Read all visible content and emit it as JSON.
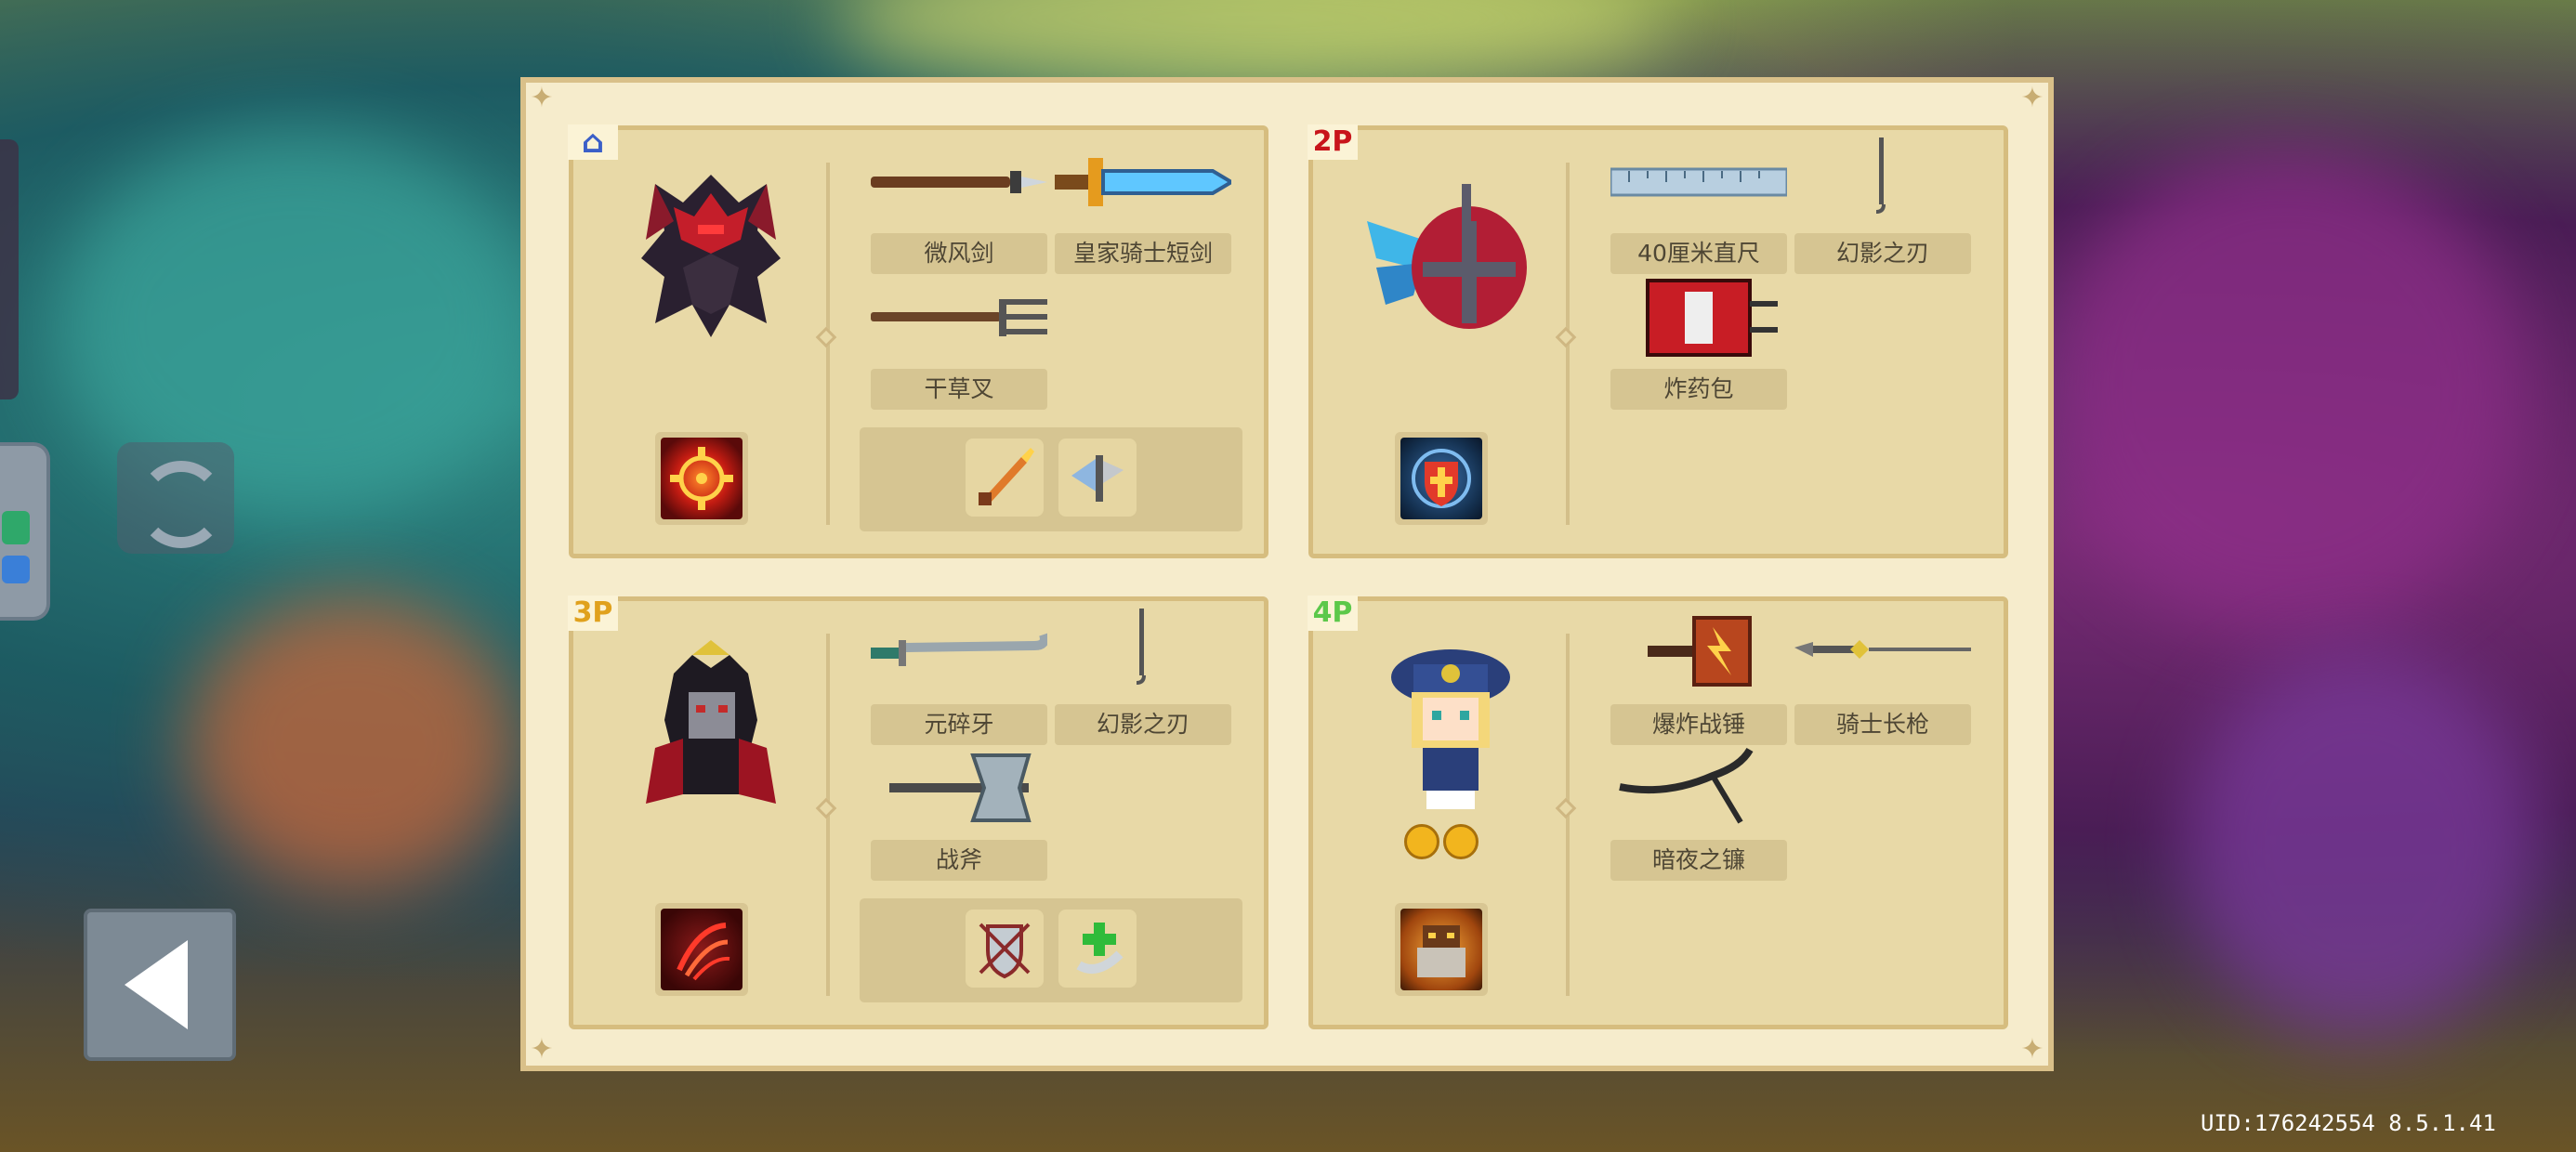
{
  "players": [
    {
      "tag": "⌂",
      "tag_color": "#3b5fc8",
      "character": "dark-red-armored-knight",
      "skill_icon": "crosshair-target-icon",
      "weapons": [
        "微风剑",
        "皇家骑士短剑",
        "干草叉"
      ],
      "buffs": [
        "flame-sword-buff-icon",
        "wing-axe-buff-icon"
      ]
    },
    {
      "tag": "2P",
      "tag_color": "#c8151b",
      "character": "winged-red-helmet",
      "skill_icon": "cross-shield-icon",
      "weapons": [
        "40厘米直尺",
        "幻影之刃",
        "炸药包"
      ],
      "buffs": []
    },
    {
      "tag": "3P",
      "tag_color": "#e0a11d",
      "character": "dark-crowned-vampire",
      "skill_icon": "crimson-claw-icon",
      "weapons": [
        "元碎牙",
        "幻影之刃",
        "战斧"
      ],
      "buffs": [
        "shield-emblem-buff-icon",
        "healing-cross-buff-icon"
      ]
    },
    {
      "tag": "4P",
      "tag_color": "#5cc84a",
      "character": "blonde-officer-girl",
      "skill_icon": "golden-golem-icon",
      "weapons": [
        "爆炸战锤",
        "骑士长枪",
        "暗夜之镰"
      ],
      "buffs": [],
      "badges": [
        "gold-coin-badge",
        "gold-coin-badge"
      ]
    }
  ],
  "uid_text": "UID:176242554 8.5.1.41"
}
